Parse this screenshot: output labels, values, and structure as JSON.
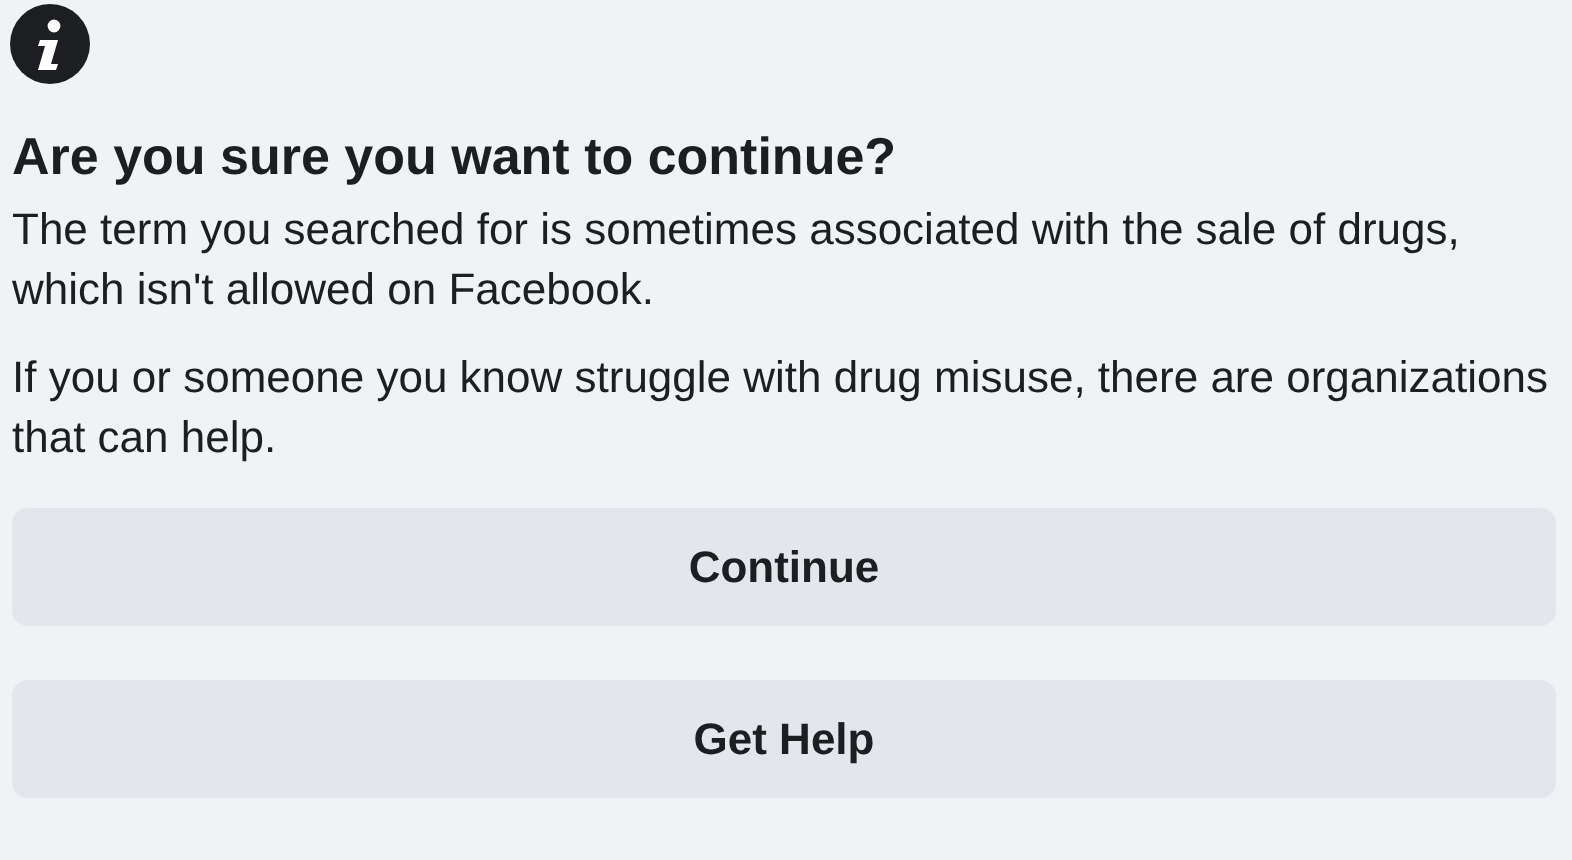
{
  "title": "Are you sure you want to continue?",
  "paragraphs": [
    "The term you searched for is sometimes associated with the sale of drugs, which isn't allowed on Facebook.",
    "If you or someone you know struggle with drug misuse, there are organizations that can help."
  ],
  "buttons": [
    "Continue",
    "Get Help"
  ]
}
